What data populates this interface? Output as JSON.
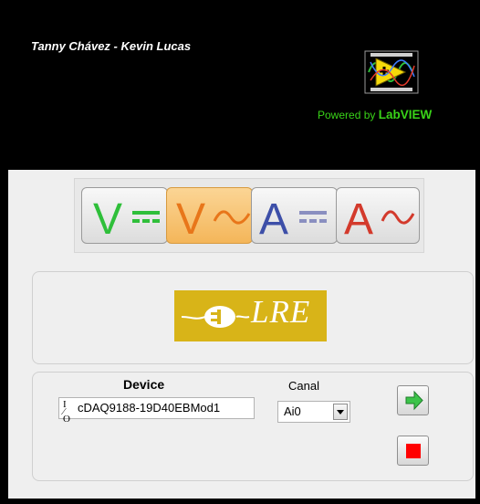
{
  "header": {
    "authors": "Tanny Chávez - Kevin Lucas",
    "powered_by_prefix": "Powered by",
    "powered_by_brand": "LabVIEW",
    "logo_icon": "labview-vi-icon"
  },
  "mode_buttons": [
    {
      "name": "voltage-dc",
      "letter": "V",
      "symbol": "dc",
      "color": "#2fbf3a",
      "active": false
    },
    {
      "name": "voltage-ac",
      "letter": "V",
      "symbol": "ac",
      "color": "#e8761a",
      "active": true
    },
    {
      "name": "current-dc",
      "letter": "A",
      "symbol": "dc",
      "color": "#3d4fa8",
      "active": false
    },
    {
      "name": "current-ac",
      "letter": "A",
      "symbol": "ac",
      "color": "#d33a2c",
      "active": false
    }
  ],
  "lre_logo": {
    "text": "LRE",
    "color": "#d8b418"
  },
  "device": {
    "label": "Device",
    "value": "cDAQ9188-19D40EBMod1",
    "icon": "io-name-icon"
  },
  "canal": {
    "label": "Canal",
    "value": "Ai0"
  },
  "controls": {
    "run_icon": "green-arrow-icon",
    "stop_icon": "red-stop-icon"
  }
}
